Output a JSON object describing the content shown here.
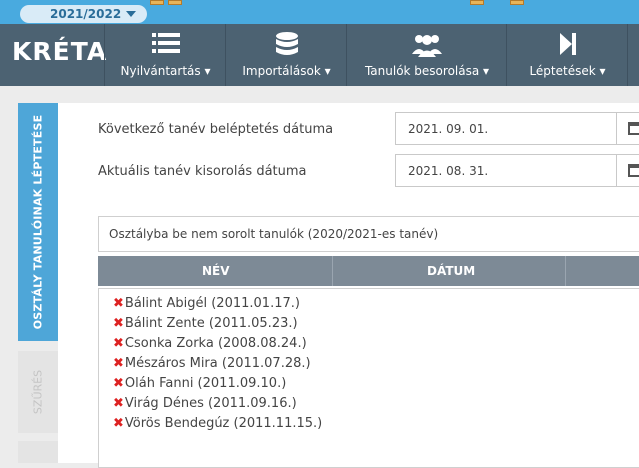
{
  "topbar": {
    "school_year": "2021/2022"
  },
  "logo": "KRÉTA",
  "nav": [
    {
      "label": "Nyilvántartás",
      "icon": "list-icon"
    },
    {
      "label": "Importálások",
      "icon": "database-icon"
    },
    {
      "label": "Tanulók besorolása",
      "icon": "users-icon"
    },
    {
      "label": "Léptetések",
      "icon": "step-forward-icon"
    }
  ],
  "side_tabs": {
    "active": "OSZTÁLY TANULÓINAK LÉPTETÉSE",
    "inactive": "SZŰRÉS"
  },
  "form": {
    "next_year_label": "Következő tanév beléptetés dátuma",
    "next_year_value": "2021. 09. 01.",
    "current_year_label": "Aktuális tanév kisorolás dátuma",
    "current_year_value": "2021. 08. 31."
  },
  "source_select": "Osztályba be nem sorolt tanulók (2020/2021-es tanév)",
  "table": {
    "columns": [
      "NÉV",
      "DÁTUM"
    ],
    "rows": [
      "Bálint Abigél (2011.01.17.)",
      "Bálint Zente (2011.05.23.)",
      "Csonka Zorka (2008.08.24.)",
      "Mészáros Mira (2011.07.28.)",
      "Oláh Fanni (2011.09.10.)",
      "Virág Dénes (2011.09.16.)",
      "Vörös Bendegúz (2011.11.15.)"
    ]
  }
}
